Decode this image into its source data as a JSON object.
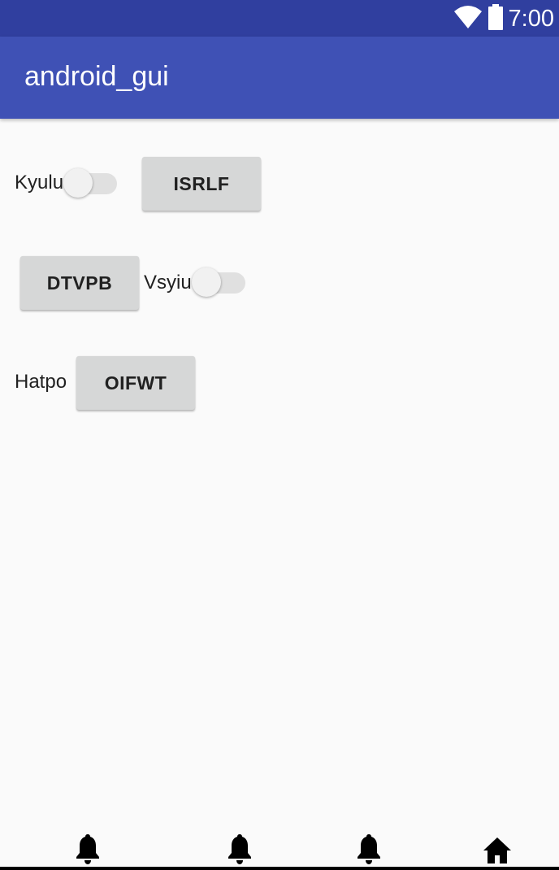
{
  "status_bar": {
    "time": "7:00",
    "wifi_icon": "wifi-icon",
    "battery_icon": "battery-icon",
    "color": "#303f9f"
  },
  "app_bar": {
    "title": "android_gui",
    "color": "#3f51b5"
  },
  "rows": [
    {
      "switch_label": "Kyulu",
      "switch_on": false,
      "button_label": "ISRLF"
    },
    {
      "button_label": "DTVPB",
      "switch_label": "Vsyiu",
      "switch_on": false
    },
    {
      "text_label": "Hatpo",
      "button_label": "OIFWT"
    }
  ],
  "bottom_nav": {
    "items": [
      {
        "icon": "bell-icon"
      },
      {
        "icon": "bell-icon"
      },
      {
        "icon": "bell-icon"
      },
      {
        "icon": "home-icon"
      }
    ]
  }
}
